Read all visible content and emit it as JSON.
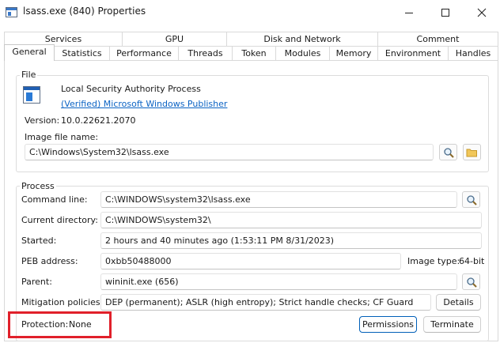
{
  "window": {
    "title": "lsass.exe (840) Properties"
  },
  "tabs": {
    "row1": [
      "Services",
      "GPU",
      "Disk and Network",
      "Comment"
    ],
    "row2": [
      "General",
      "Statistics",
      "Performance",
      "Threads",
      "Token",
      "Modules",
      "Memory",
      "Environment",
      "Handles"
    ],
    "active": "General"
  },
  "file": {
    "legend": "File",
    "description": "Local Security Authority Process",
    "publisher_link": "(Verified) Microsoft Windows Publisher",
    "version_label": "Version:",
    "version": "10.0.22621.2070",
    "image_label": "Image file name:",
    "image_path": "C:\\Windows\\System32\\lsass.exe"
  },
  "process": {
    "legend": "Process",
    "command_line_label": "Command line:",
    "command_line": "C:\\WINDOWS\\system32\\lsass.exe",
    "current_directory_label": "Current directory:",
    "current_directory": "C:\\WINDOWS\\system32\\",
    "started_label": "Started:",
    "started": "2 hours and 40 minutes ago (1:53:11 PM 8/31/2023)",
    "peb_label": "PEB address:",
    "peb": "0xbb50488000",
    "image_type_label": "Image type:",
    "image_type": "64-bit",
    "parent_label": "Parent:",
    "parent": "wininit.exe (656)",
    "mitigation_label": "Mitigation policies:",
    "mitigation": "DEP (permanent); ASLR (high entropy); Strict handle checks; CF Guard",
    "details_button": "Details",
    "protection_label": "Protection:",
    "protection": "None",
    "permissions_button": "Permissions",
    "terminate_button": "Terminate"
  },
  "colors": {
    "accent": "#005fb8",
    "link": "#0b63c4",
    "highlight": "#e0202a"
  }
}
